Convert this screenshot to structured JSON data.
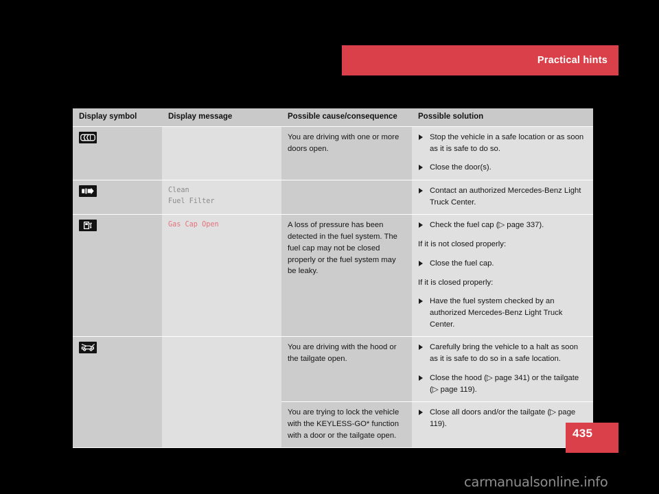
{
  "header": {
    "title": "Practical hints",
    "accent_color": "#d9404a"
  },
  "page_number": "435",
  "watermark": "carmanualsonline.info",
  "table": {
    "columns": [
      {
        "key": "symbol",
        "label": "Display symbol"
      },
      {
        "key": "message",
        "label": "Display message"
      },
      {
        "key": "cause",
        "label": "Possible cause/consequence"
      },
      {
        "key": "solution",
        "label": "Possible solution"
      }
    ],
    "rows": [
      {
        "symbol_icon": "car-doors-open-icon",
        "message": "",
        "message_color": "",
        "cause": "You are driving with one or more doors open.",
        "solution": [
          {
            "type": "bullet",
            "text": "Stop the vehicle in a safe location or as soon as it is safe to do so."
          },
          {
            "type": "bullet",
            "text": "Close the door(s)."
          }
        ]
      },
      {
        "symbol_icon": "fuel-filter-icon",
        "message": "Clean\nFuel Filter",
        "message_color": "gray",
        "cause": "",
        "solution": [
          {
            "type": "bullet",
            "text": "Contact an authorized Mercedes-Benz Light Truck Center."
          }
        ]
      },
      {
        "symbol_icon": "fuel-pump-icon",
        "message": "Gas Cap Open",
        "message_color": "red",
        "cause": "A loss of pressure has been detected in the fuel system. The fuel cap may not be closed properly or the fuel system may be leaky.",
        "solution": [
          {
            "type": "bullet",
            "text": "Check the fuel cap (▷ page 337)."
          },
          {
            "type": "plain",
            "text": "If it is not closed properly:"
          },
          {
            "type": "bullet",
            "text": "Close the fuel cap."
          },
          {
            "type": "plain",
            "text": "If it is closed properly:"
          },
          {
            "type": "bullet",
            "text": "Have the fuel system checked by an authorized Mercedes-Benz Light Truck Center."
          }
        ]
      },
      {
        "symbol_icon": "car-hood-tailgate-open-icon",
        "message": "",
        "message_color": "",
        "cause": "You are driving with the hood or the tailgate open.",
        "solution": [
          {
            "type": "bullet",
            "text": "Carefully bring the vehicle to a halt as soon as it is safe to do so in a safe location."
          },
          {
            "type": "bullet",
            "text": "Close the hood (▷ page 341) or the tailgate (▷ page 119)."
          }
        ]
      },
      {
        "symbol_icon": "",
        "message": "",
        "message_color": "",
        "cause": "You are trying to lock the vehicle with the KEYLESS-GO* function with a door or the tailgate open.",
        "solution": [
          {
            "type": "bullet",
            "text": "Close all doors and/or the tailgate (▷ page 119)."
          }
        ]
      }
    ]
  }
}
